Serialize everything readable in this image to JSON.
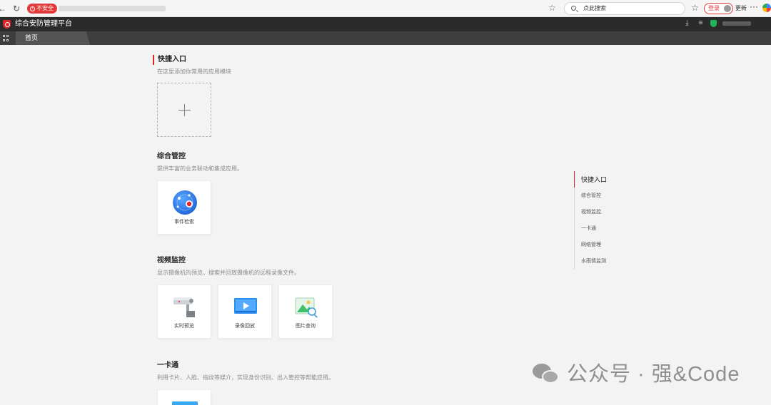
{
  "browser": {
    "security_badge": "不安全",
    "search_placeholder": "点此搜索",
    "login_label": "登录",
    "update_label": "更新",
    "more_label": "···"
  },
  "app": {
    "title": "综合安防管理平台"
  },
  "tabs": [
    {
      "label": "首页",
      "active": true
    }
  ],
  "sections": {
    "quick": {
      "title": "快捷入口",
      "desc": "在这里添加你常用的应用模块"
    },
    "integrated": {
      "title": "综合管控",
      "desc": "提供丰富的业务联动和集成应用。",
      "cards": [
        {
          "label": "事件检索",
          "icon": "event-search-icon"
        }
      ]
    },
    "video": {
      "title": "视频监控",
      "desc": "显示摄像机的预览，搜索并回放摄像机的远程录像文件。",
      "cards": [
        {
          "label": "实时预览",
          "icon": "camera-icon"
        },
        {
          "label": "录像回放",
          "icon": "video-playback-icon"
        },
        {
          "label": "图片查询",
          "icon": "image-search-icon"
        }
      ]
    },
    "card_access": {
      "title": "一卡通",
      "desc": "利用卡片、人脸、指纹等媒介，实现身份识别、出入管控等帮能应用。"
    }
  },
  "anchor_nav": [
    {
      "label": "快捷入口",
      "active": true
    },
    {
      "label": "综合管控"
    },
    {
      "label": "视频监控"
    },
    {
      "label": "一卡通"
    },
    {
      "label": "网络管理"
    },
    {
      "label": "水雨情监测"
    }
  ],
  "watermark": {
    "text": "公众号 · 强&Code"
  },
  "colors": {
    "accent": "#e0242c",
    "header_bg": "#2b2b2b",
    "tab_bg": "#3d3d3d",
    "page_bg": "#f3f3f3"
  }
}
